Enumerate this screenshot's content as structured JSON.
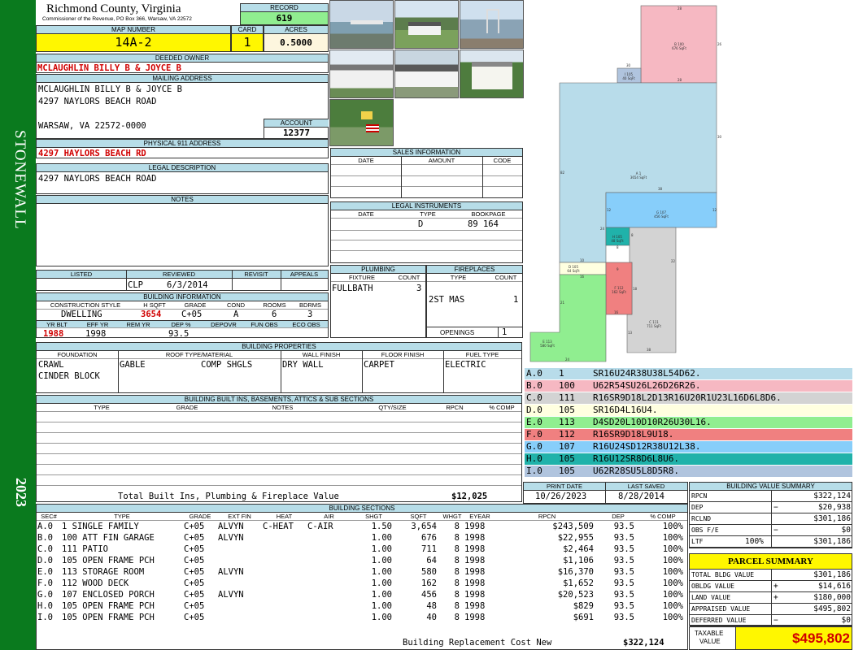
{
  "sidebar": {
    "district": "STONEWALL",
    "year": "2023"
  },
  "header": {
    "county": "Richmond County, Virginia",
    "commissioner": "Commissioner of the Revenue, PO Box 366, Warsaw, VA 22572",
    "record_label": "RECORD",
    "record": "619",
    "map_label": "MAP NUMBER",
    "map_number": "14A-2",
    "card_label": "CARD",
    "card": "1",
    "acres_label": "ACRES",
    "acres": "0.5000"
  },
  "owner": {
    "deeded_label": "DEEDED OWNER",
    "deeded": "MCLAUGHLIN BILLY B & JOYCE B",
    "mailing_label": "MAILING ADDRESS",
    "mail1": "MCLAUGHLIN BILLY B & JOYCE B",
    "mail2": "4297 NAYLORS BEACH ROAD",
    "mail3": "WARSAW, VA 22572-0000",
    "account_label": "ACCOUNT",
    "account": "12377",
    "physical_label": "PHYSICAL 911 ADDRESS",
    "physical": "4297 HAYLORS BEACH RD",
    "legal_label": "LEGAL DESCRIPTION",
    "legal": "4297 NAYLORS BEACH ROAD",
    "notes_label": "NOTES"
  },
  "sales": {
    "title": "SALES INFORMATION",
    "cols": [
      "DATE",
      "AMOUNT",
      "CODE"
    ]
  },
  "instruments": {
    "title": "LEGAL INSTRUMENTS",
    "cols": [
      "DATE",
      "TYPE",
      "BOOKPAGE"
    ],
    "type": "D",
    "bookpage": "89 164"
  },
  "review": {
    "cols": [
      "LISTED",
      "REVIEWED",
      "REVISIT",
      "APPEALS"
    ],
    "reviewer": "CLP",
    "reviewed_date": "6/3/2014"
  },
  "plumbing": {
    "title": "PLUMBING",
    "cols": [
      "FIXTURE",
      "COUNT"
    ],
    "fixture": "FULLBATH",
    "count": "3"
  },
  "fireplaces": {
    "title": "FIREPLACES",
    "cols": [
      "TYPE",
      "COUNT"
    ],
    "type": "2ST MAS",
    "count": "1",
    "openings_label": "OPENINGS",
    "openings": "1"
  },
  "building_info": {
    "title": "BUILDING INFORMATION",
    "cols": [
      "CONSTRUCTION STYLE",
      "H SQFT",
      "GRADE",
      "COND",
      "ROOMS",
      "BDRMS"
    ],
    "style": "DWELLING",
    "hsqft": "3654",
    "grade": "C+05",
    "cond": "A",
    "rooms": "6",
    "bdrms": "3",
    "cols2": [
      "YR BLT",
      "EFF YR",
      "REM YR",
      "DEP %",
      "DEPOVR",
      "FUN OBS",
      "ECO OBS"
    ],
    "yrblt": "1988",
    "effyr": "1998",
    "dep": "93.5"
  },
  "properties": {
    "title": "BUILDING PROPERTIES",
    "cols": [
      "FOUNDATION",
      "ROOF TYPE/MATERIAL",
      "WALL FINISH",
      "FLOOR FINISH",
      "FUEL TYPE"
    ],
    "foundation1": "CRAWL",
    "foundation2": "CINDER BLOCK",
    "roof1": "GABLE",
    "roof2": "COMP SHGLS",
    "wall": "DRY WALL",
    "floor": "CARPET",
    "fuel": "ELECTRIC"
  },
  "builtins": {
    "title": "BUILDING BUILT INS, BASEMENTS, ATTICS & SUB SECTIONS",
    "cols": [
      "TYPE",
      "GRADE",
      "NOTES",
      "QTY/SIZE",
      "RPCN",
      "% COMP"
    ],
    "total_label": "Total Built Ins, Plumbing & Fireplace Value",
    "total": "$12,025"
  },
  "sections": {
    "title": "BUILDING SECTIONS",
    "cols": [
      "SEC#",
      "TYPE",
      "GRADE",
      "EXT FIN",
      "HEAT",
      "AIR",
      "SHGT",
      "SQFT",
      "WHGT",
      "EYEAR",
      "RPCN",
      "DEP",
      "% COMP"
    ],
    "rows": [
      {
        "sec": "A.0",
        "type": "1 SINGLE FAMILY",
        "grade": "C+05",
        "ext": "ALVYN",
        "heat": "C-HEAT",
        "air": "C-AIR",
        "shgt": "1.50",
        "sqft": "3,654",
        "whgt": "8",
        "eyear": "1998",
        "rpcn": "$243,509",
        "dep": "93.5",
        "comp": "100%"
      },
      {
        "sec": "B.0",
        "type": "100 ATT FIN GARAGE",
        "grade": "C+05",
        "ext": "ALVYN",
        "heat": "",
        "air": "",
        "shgt": "1.00",
        "sqft": "676",
        "whgt": "8",
        "eyear": "1998",
        "rpcn": "$22,955",
        "dep": "93.5",
        "comp": "100%"
      },
      {
        "sec": "C.0",
        "type": "111 PATIO",
        "grade": "C+05",
        "ext": "",
        "heat": "",
        "air": "",
        "shgt": "1.00",
        "sqft": "711",
        "whgt": "8",
        "eyear": "1998",
        "rpcn": "$2,464",
        "dep": "93.5",
        "comp": "100%"
      },
      {
        "sec": "D.0",
        "type": "105 OPEN FRAME PCH",
        "grade": "C+05",
        "ext": "",
        "heat": "",
        "air": "",
        "shgt": "1.00",
        "sqft": "64",
        "whgt": "8",
        "eyear": "1998",
        "rpcn": "$1,106",
        "dep": "93.5",
        "comp": "100%"
      },
      {
        "sec": "E.0",
        "type": "113 STORAGE ROOM",
        "grade": "C+05",
        "ext": "ALVYN",
        "heat": "",
        "air": "",
        "shgt": "1.00",
        "sqft": "580",
        "whgt": "8",
        "eyear": "1998",
        "rpcn": "$16,370",
        "dep": "93.5",
        "comp": "100%"
      },
      {
        "sec": "F.0",
        "type": "112 WOOD DECK",
        "grade": "C+05",
        "ext": "",
        "heat": "",
        "air": "",
        "shgt": "1.00",
        "sqft": "162",
        "whgt": "8",
        "eyear": "1998",
        "rpcn": "$1,652",
        "dep": "93.5",
        "comp": "100%"
      },
      {
        "sec": "G.0",
        "type": "107 ENCLOSED PORCH",
        "grade": "C+05",
        "ext": "ALVYN",
        "heat": "",
        "air": "",
        "shgt": "1.00",
        "sqft": "456",
        "whgt": "8",
        "eyear": "1998",
        "rpcn": "$20,523",
        "dep": "93.5",
        "comp": "100%"
      },
      {
        "sec": "H.0",
        "type": "105 OPEN FRAME PCH",
        "grade": "C+05",
        "ext": "",
        "heat": "",
        "air": "",
        "shgt": "1.00",
        "sqft": "48",
        "whgt": "8",
        "eyear": "1998",
        "rpcn": "$829",
        "dep": "93.5",
        "comp": "100%"
      },
      {
        "sec": "I.0",
        "type": "105 OPEN FRAME PCH",
        "grade": "C+05",
        "ext": "",
        "heat": "",
        "air": "",
        "shgt": "1.00",
        "sqft": "40",
        "whgt": "8",
        "eyear": "1998",
        "rpcn": "$691",
        "dep": "93.5",
        "comp": "100%"
      }
    ],
    "total_label": "Building Replacement Cost New",
    "total": "$322,124"
  },
  "sketch": {
    "labels": {
      "b": "B 100\n676 SqFt",
      "a": "A 1\n3654 SqFt",
      "g": "G 107\n456 SqFt",
      "i": "I 105\n40 SqFt",
      "h": "H 105\n48 SqFt",
      "d": "D 105\n64 SqFt",
      "f": "F 112\n162 SqFt",
      "c": "C 111\n711 SqFt",
      "e": "E 113\n580 SqFt"
    },
    "dims": [
      "28",
      "28",
      "26",
      "30",
      "30",
      "82",
      "12",
      "12",
      "24",
      "8",
      "8",
      "10",
      "22",
      "38",
      "18",
      "16",
      "9",
      "16",
      "13",
      "21",
      "24",
      "38"
    ]
  },
  "legend": [
    {
      "sec": "A.0",
      "code": "1",
      "desc": "SR16U24R38U38L54D62.",
      "color": "#b8dcea"
    },
    {
      "sec": "B.0",
      "code": "100",
      "desc": "U62R54SU26L26D26R26.",
      "color": "#f6b8c2"
    },
    {
      "sec": "C.0",
      "code": "111",
      "desc": "R16SR9D18L2D13R16U20R1U23L16D6L8D6.",
      "color": "#d3d3d3"
    },
    {
      "sec": "D.0",
      "code": "105",
      "desc": "SR16D4L16U4.",
      "color": "#ffffe0"
    },
    {
      "sec": "E.0",
      "code": "113",
      "desc": "D4SD20L10D10R26U30L16.",
      "color": "#90ee90"
    },
    {
      "sec": "F.0",
      "code": "112",
      "desc": "R16SR9D18L9U18.",
      "color": "#f08080"
    },
    {
      "sec": "G.0",
      "code": "107",
      "desc": "R16U24SD12R38U12L38.",
      "color": "#87cefa"
    },
    {
      "sec": "H.0",
      "code": "105",
      "desc": "R16U12SR8D6L8U6.",
      "color": "#20b2aa"
    },
    {
      "sec": "I.0",
      "code": "105",
      "desc": "U62R28SU5L8D5R8.",
      "color": "#b0c4de"
    }
  ],
  "dates": {
    "print_label": "PRINT DATE",
    "print": "10/26/2023",
    "saved_label": "LAST SAVED",
    "saved": "8/28/2014"
  },
  "value_summary": {
    "title": "BUILDING VALUE SUMMARY",
    "rows": [
      {
        "label": "RPCN",
        "sign": "",
        "pct": "",
        "value": "$322,124"
      },
      {
        "label": "DEP",
        "sign": "−",
        "pct": "",
        "value": "$20,938"
      },
      {
        "label": "RCLND",
        "sign": "",
        "pct": "",
        "value": "$301,186"
      },
      {
        "label": "OBS F/E",
        "sign": "−",
        "pct": "",
        "value": "$0"
      },
      {
        "label": "LTF",
        "sign": "",
        "pct": "100%",
        "value": "$301,186"
      }
    ]
  },
  "parcel": {
    "title": "PARCEL SUMMARY",
    "rows": [
      {
        "label": "TOTAL BLDG VALUE",
        "sign": "",
        "value": "$301,186"
      },
      {
        "label": "OBLDG VALUE",
        "sign": "+",
        "value": "$14,616"
      },
      {
        "label": "LAND VALUE",
        "sign": "+",
        "value": "$180,000"
      },
      {
        "label": "APPRAISED VALUE",
        "sign": "",
        "value": "$495,802"
      },
      {
        "label": "DEFERRED VALUE",
        "sign": "−",
        "value": "$0"
      }
    ],
    "taxable_label1": "TAXABLE",
    "taxable_label2": "VALUE",
    "taxable": "$495,802"
  },
  "colors": {
    "sidebar": "#0a7a1e",
    "header_blue": "#b7dde8",
    "record_green": "#90ee90",
    "map_yellow": "#fff700",
    "red_text": "#d00000"
  }
}
